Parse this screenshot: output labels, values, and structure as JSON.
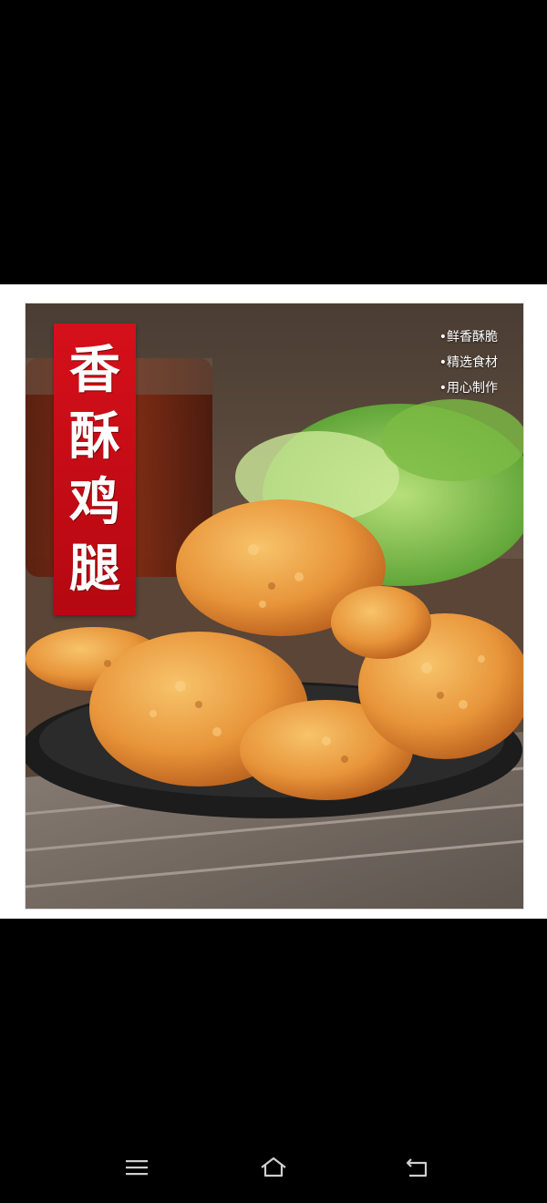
{
  "image": {
    "title_chars": [
      "香",
      "酥",
      "鸡",
      "腿"
    ],
    "features": [
      "•鲜香酥脆",
      "•精选食材",
      "•用心制作"
    ]
  },
  "navbar": {
    "menu_icon": "menu-icon",
    "home_icon": "home-icon",
    "back_icon": "back-icon"
  },
  "colors": {
    "banner_red": "#d5101a",
    "background": "#000000",
    "viewer_bg": "#ffffff"
  }
}
